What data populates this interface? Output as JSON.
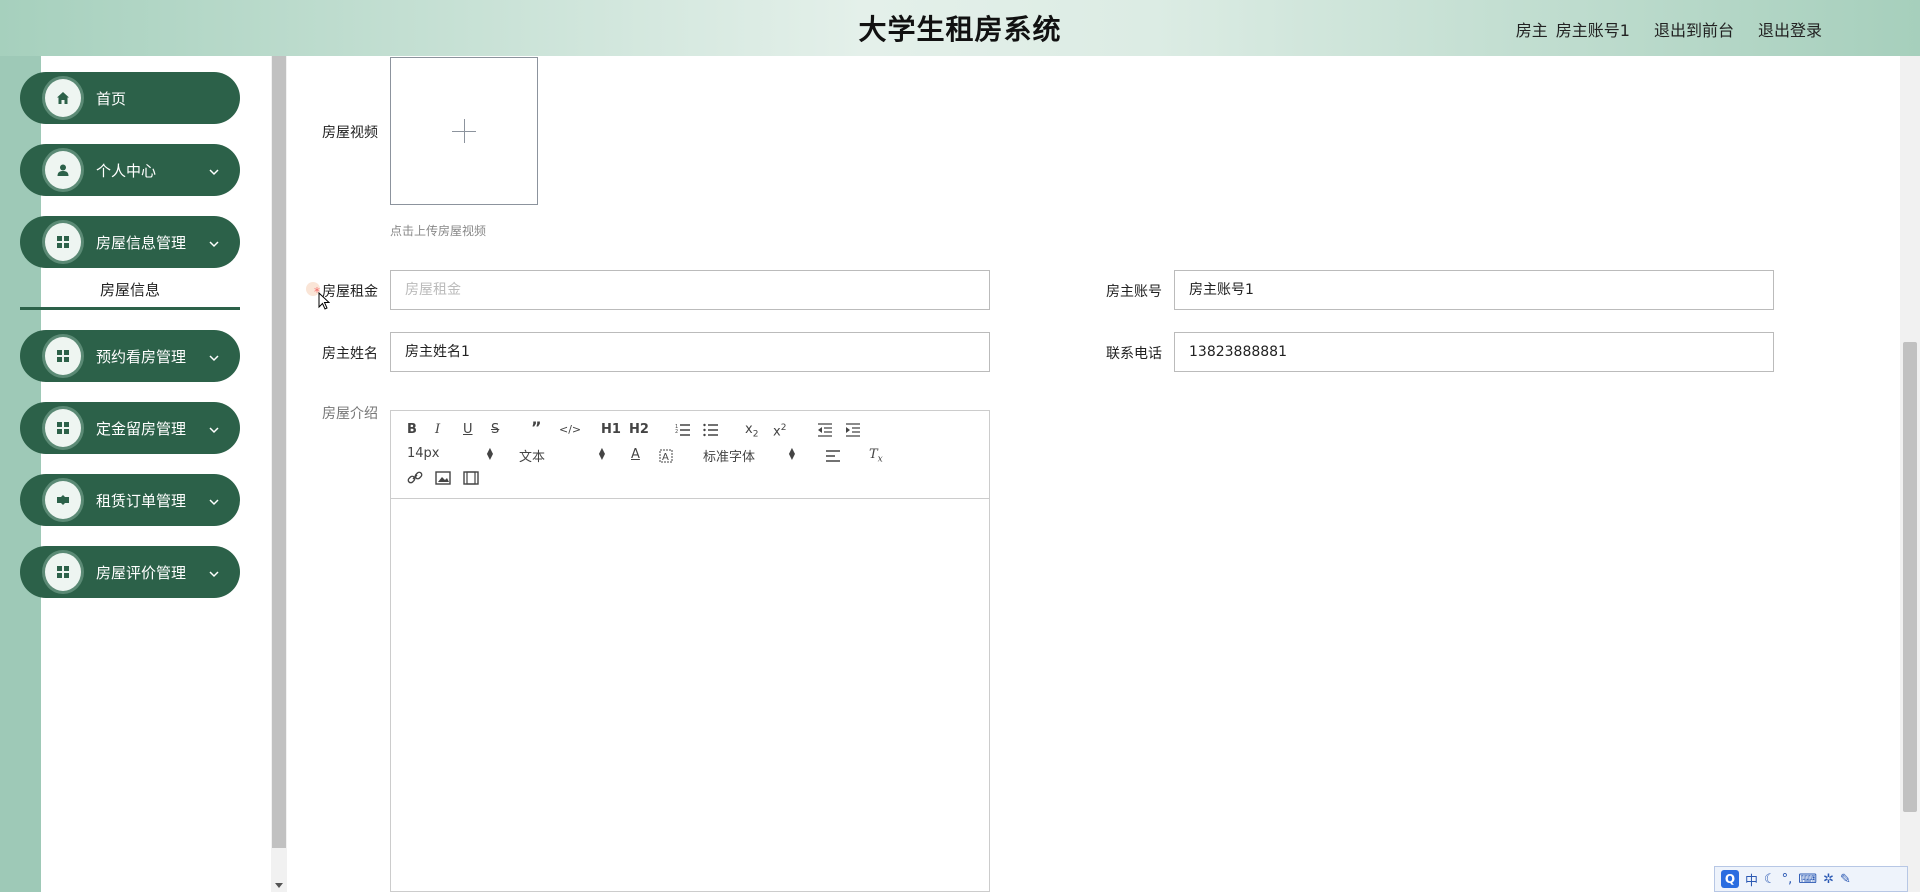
{
  "header": {
    "title": "大学生租房系统",
    "role": "房主",
    "account": "房主账号1",
    "to_frontend": "退出到前台",
    "logout": "退出登录"
  },
  "sidebar": {
    "items": [
      {
        "label": "首页",
        "icon": "home-icon",
        "has_chevron": false
      },
      {
        "label": "个人中心",
        "icon": "user-icon",
        "has_chevron": true
      },
      {
        "label": "房屋信息管理",
        "icon": "grid-icon",
        "has_chevron": true
      },
      {
        "label": "预约看房管理",
        "icon": "grid-icon",
        "has_chevron": true
      },
      {
        "label": "定金留房管理",
        "icon": "grid-icon",
        "has_chevron": true
      },
      {
        "label": "租赁订单管理",
        "icon": "ticket-icon",
        "has_chevron": true
      },
      {
        "label": "房屋评价管理",
        "icon": "grid-icon",
        "has_chevron": true
      }
    ],
    "submenu_label": "房屋信息"
  },
  "form": {
    "video_label": "房屋视频",
    "video_hint": "点击上传房屋视频",
    "rent_label": "房屋租金",
    "rent_required_mark": "*",
    "rent_placeholder": "房屋租金",
    "owner_account_label": "房主账号",
    "owner_account_value": "房主账号1",
    "owner_name_label": "房主姓名",
    "owner_name_value": "房主姓名1",
    "phone_label": "联系电话",
    "phone_value": "13823888881",
    "intro_label": "房屋介绍"
  },
  "editor": {
    "size_value": "14px",
    "heading_value": "文本",
    "font_value": "标准字体",
    "h1": "H1",
    "h2": "H2"
  },
  "ime": {
    "mode": "中"
  },
  "colors": {
    "accent": "#2c6149",
    "header_start": "#a6d0bd",
    "header_mid": "#e4f0ea",
    "required": "#f56c6c"
  }
}
